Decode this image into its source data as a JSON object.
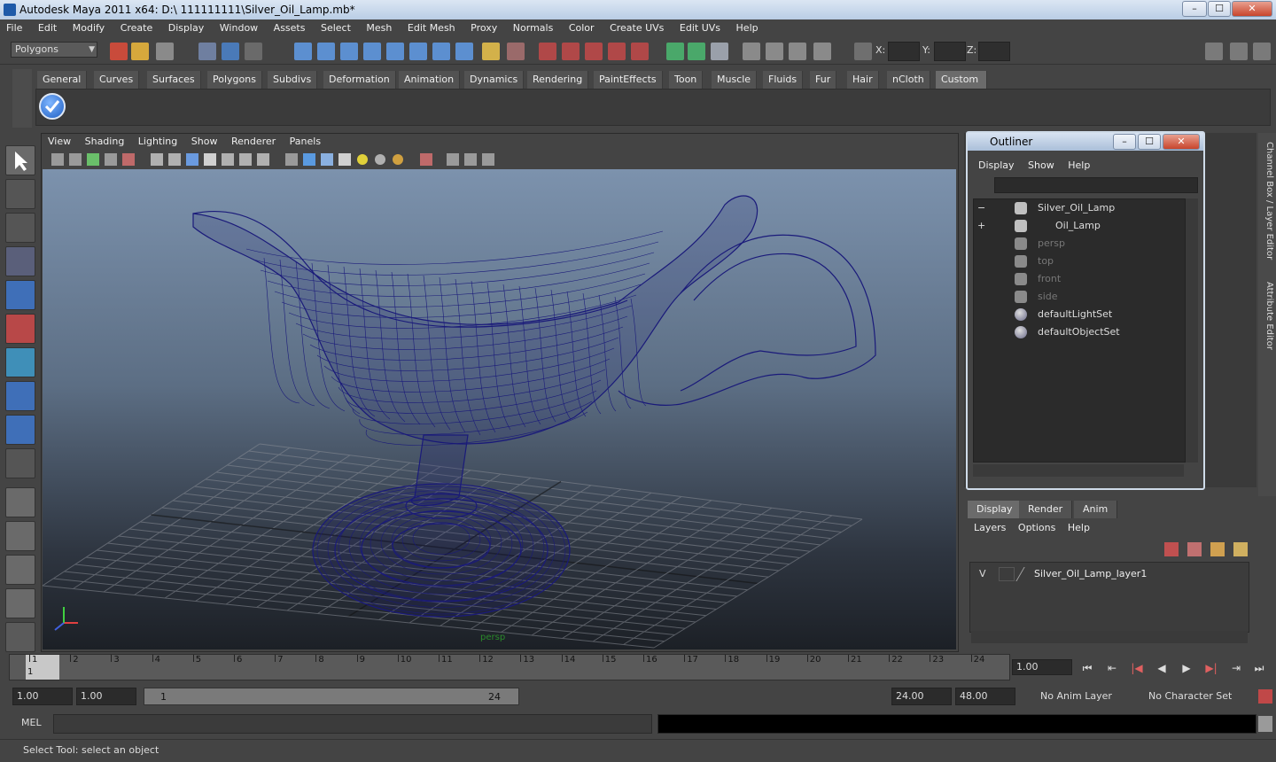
{
  "window": {
    "title": "Autodesk Maya 2011 x64: D:\\ 111111111\\Silver_Oil_Lamp.mb*",
    "min": "–",
    "max": "☐",
    "close": "✕"
  },
  "menubar": [
    "File",
    "Edit",
    "Modify",
    "Create",
    "Display",
    "Window",
    "Assets",
    "Select",
    "Mesh",
    "Edit Mesh",
    "Proxy",
    "Normals",
    "Color",
    "Create UVs",
    "Edit UVs",
    "Help"
  ],
  "statusline": {
    "mode": "Polygons",
    "x_label": "X:",
    "y_label": "Y:",
    "z_label": "Z:"
  },
  "shelf": {
    "tabs": [
      "General",
      "Curves",
      "Surfaces",
      "Polygons",
      "Subdivs",
      "Deformation",
      "Animation",
      "Dynamics",
      "Rendering",
      "PaintEffects",
      "Toon",
      "Muscle",
      "Fluids",
      "Fur",
      "Hair",
      "nCloth",
      "Custom"
    ],
    "active": "Custom"
  },
  "viewport": {
    "menu": [
      "View",
      "Shading",
      "Lighting",
      "Show",
      "Renderer",
      "Panels"
    ],
    "camera_label": "persp",
    "wire_color": "#1a1a7a"
  },
  "outliner": {
    "title": "Outliner",
    "menu": [
      "Display",
      "Show",
      "Help"
    ],
    "items": [
      {
        "label": "Silver_Oil_Lamp",
        "expand": "−",
        "dim": false,
        "icon": "mesh-transform-icon"
      },
      {
        "label": "Oil_Lamp",
        "expand": "+",
        "dim": false,
        "icon": "mesh-transform-icon"
      },
      {
        "label": "persp",
        "dim": true,
        "icon": "camera-icon"
      },
      {
        "label": "top",
        "dim": true,
        "icon": "camera-icon"
      },
      {
        "label": "front",
        "dim": true,
        "icon": "camera-icon"
      },
      {
        "label": "side",
        "dim": true,
        "icon": "camera-icon"
      },
      {
        "label": "defaultLightSet",
        "dim": false,
        "icon": "set-icon"
      },
      {
        "label": "defaultObjectSet",
        "dim": false,
        "icon": "set-icon"
      }
    ]
  },
  "side_tabs": [
    "Channel Box / Layer Editor",
    "Attribute Editor"
  ],
  "layers": {
    "tabs": [
      "Display",
      "Render",
      "Anim"
    ],
    "active": "Display",
    "menu": [
      "Layers",
      "Options",
      "Help"
    ],
    "rows": [
      {
        "visible": "V",
        "name": "Silver_Oil_Lamp_layer1"
      }
    ]
  },
  "timeline": {
    "ticks": [
      "1",
      "2",
      "3",
      "4",
      "5",
      "6",
      "7",
      "8",
      "9",
      "10",
      "11",
      "12",
      "13",
      "14",
      "15",
      "16",
      "17",
      "18",
      "19",
      "20",
      "21",
      "22",
      "23",
      "24"
    ],
    "current_marker": "1",
    "current_frame": "1.00",
    "playback": [
      "⏮",
      "⇤",
      "|◀",
      "◀",
      "▶",
      "▶|",
      "⇥",
      "⏭"
    ]
  },
  "range": {
    "start": "1.00",
    "playback_start": "1.00",
    "slider_start": "1",
    "slider_end": "24",
    "playback_end": "24.00",
    "end": "48.00",
    "anim_layer": "No Anim Layer",
    "character_set": "No Character Set"
  },
  "command": {
    "label": "MEL"
  },
  "help_line": "Select Tool: select an object"
}
